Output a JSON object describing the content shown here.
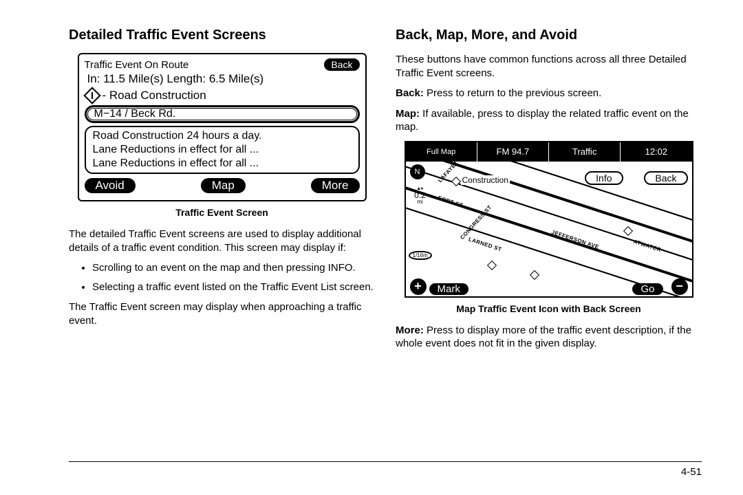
{
  "left": {
    "heading": "Detailed Traffic Event Screens",
    "traffic_screen": {
      "title": "Traffic Event On Route",
      "back": "Back",
      "metrics": "In: 11.5 Mile(s)  Length: 6.5 Mile(s)",
      "type_label": "- Road Construction",
      "road": "M−14 / Beck Rd.",
      "desc_line1": "Road Construction 24 hours a day.",
      "desc_line2": "Lane Reductions in effect for all ...",
      "desc_line3": "Lane Reductions in effect for all ...",
      "avoid": "Avoid",
      "map": "Map",
      "more": "More"
    },
    "fig_caption": "Traffic Event Screen",
    "intro": "The detailed Traffic Event screens are used to display additional details of a traffic event condition. This screen may display if:",
    "bullets": [
      "Scrolling to an event on the map and then pressing INFO.",
      "Selecting a traffic event listed on the Traffic Event List screen."
    ],
    "after": "The Traffic Event screen may display when approaching a traffic event."
  },
  "right": {
    "heading": "Back, Map, More, and Avoid",
    "intro": "These buttons have common functions across all three Detailed Traffic Event screens.",
    "back_term": "Back:",
    "back_def": " Press to return to the previous screen.",
    "map_term": "Map:",
    "map_def": " If available, press to display the related traffic event on the map.",
    "map_screen": {
      "tab_fullmap": "Full Map",
      "tab_fm": "FM 94.7",
      "tab_traffic": "Traffic",
      "tab_time": "12:02",
      "compass": "N",
      "scale_val": "0.2",
      "scale_unit": "mi",
      "construction": "Construction",
      "info": "Info",
      "back": "Back",
      "mark": "Mark",
      "go": "Go",
      "plus": "+",
      "minus": "−",
      "miniscale": "1/16m",
      "streets": {
        "lafayette": "LAFAYETTE",
        "fort": "FORT ST",
        "congress": "CONGRESS ST",
        "larned": "LARNED ST",
        "jefferson": "JEFFERSON AVE",
        "atwater": "ATWATER"
      }
    },
    "fig_caption": "Map Traffic Event Icon with Back Screen",
    "more_term": "More:",
    "more_def": " Press to display more of the traffic event description, if the whole event does not fit in the given display."
  },
  "page_number": "4-51"
}
